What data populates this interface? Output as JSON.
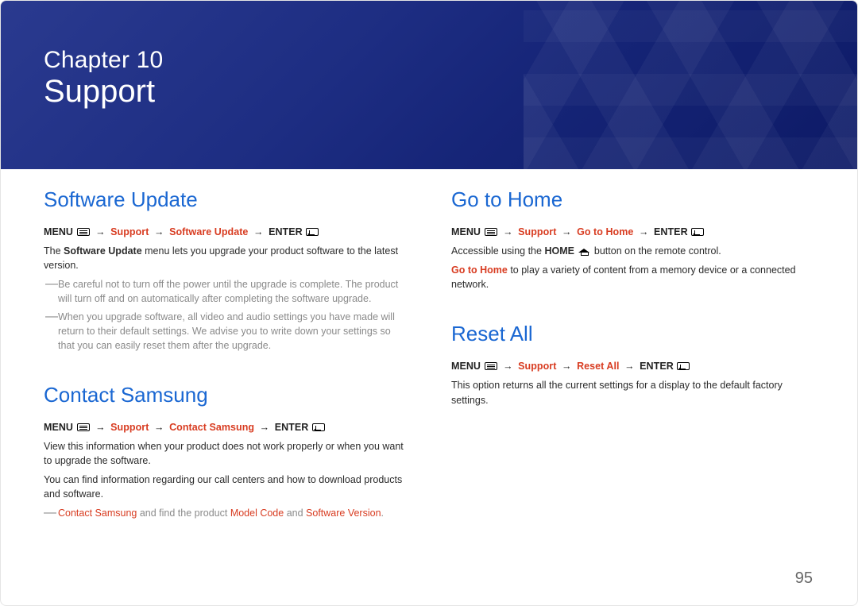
{
  "header": {
    "chapter_line": "Chapter 10",
    "chapter_title": "Support"
  },
  "left": {
    "software_update": {
      "heading": "Software Update",
      "path": {
        "menu": "MENU",
        "p1": "Support",
        "p2": "Software Update",
        "enter": "ENTER"
      },
      "intro_pre": "The ",
      "intro_bold": "Software Update",
      "intro_post": " menu lets you upgrade your product software to the latest version.",
      "notes": [
        "Be careful not to turn off the power until the upgrade is complete. The product will turn off and on automatically after completing the software upgrade.",
        "When you upgrade software, all video and audio settings you have made will return to their default settings. We advise you to write down your settings so that you can easily reset them after the upgrade."
      ]
    },
    "contact_samsung": {
      "heading": "Contact Samsung",
      "path": {
        "menu": "MENU",
        "p1": "Support",
        "p2": "Contact Samsung",
        "enter": "ENTER"
      },
      "para1": "View this information when your product does not work properly or when you want to upgrade the software.",
      "para2": "You can find information regarding our call centers and how to download products and software.",
      "tip_a": "Contact Samsung",
      "tip_mid": " and find the product ",
      "tip_b": "Model Code",
      "tip_and": " and ",
      "tip_c": "Software Version",
      "tip_end": "."
    }
  },
  "right": {
    "go_to_home": {
      "heading": "Go to Home",
      "path": {
        "menu": "MENU",
        "p1": "Support",
        "p2": "Go to Home",
        "enter": "ENTER"
      },
      "line1_pre": "Accessible using the ",
      "line1_home": "HOME",
      "line1_post": " button on the remote control.",
      "line2_red": "Go to Home",
      "line2_post": " to play a variety of content from a memory device or a connected network."
    },
    "reset_all": {
      "heading": "Reset All",
      "path": {
        "menu": "MENU",
        "p1": "Support",
        "p2": "Reset All",
        "enter": "ENTER"
      },
      "para": "This option returns all the current settings for a display to the default factory settings."
    }
  },
  "page_number": "95",
  "glyphs": {
    "arrow": "→"
  }
}
